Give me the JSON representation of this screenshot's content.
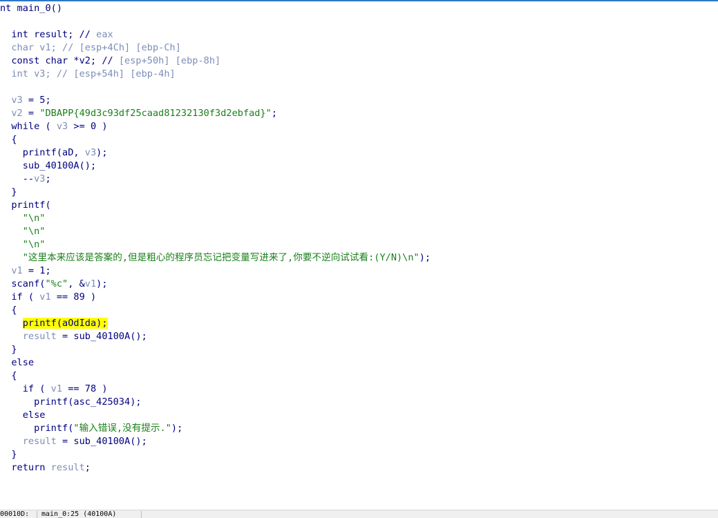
{
  "editor": {
    "lines": [
      [
        {
          "t": "nt main_0()",
          "c": "kw"
        }
      ],
      [
        {
          "t": "",
          "c": "kw"
        }
      ],
      [
        {
          "t": "  int result; // ",
          "c": "kw"
        },
        {
          "t": "eax",
          "c": "cm"
        }
      ],
      [
        {
          "t": "  ",
          "c": "kw"
        },
        {
          "t": "char v1; // [esp+4Ch] [ebp-Ch]",
          "c": "var"
        }
      ],
      [
        {
          "t": "  const char *v2; // ",
          "c": "kw"
        },
        {
          "t": "[esp+50h] [ebp-8h]",
          "c": "cm"
        }
      ],
      [
        {
          "t": "  ",
          "c": "kw"
        },
        {
          "t": "int v3; // [esp+54h] [ebp-4h]",
          "c": "var"
        }
      ],
      [
        {
          "t": "",
          "c": "kw"
        }
      ],
      [
        {
          "t": "  ",
          "c": "kw"
        },
        {
          "t": "v3",
          "c": "var"
        },
        {
          "t": " = 5;",
          "c": "kw"
        }
      ],
      [
        {
          "t": "  ",
          "c": "kw"
        },
        {
          "t": "v2",
          "c": "var"
        },
        {
          "t": " = ",
          "c": "kw"
        },
        {
          "t": "\"DBAPP{49d3c93df25caad81232130f3d2ebfad}\"",
          "c": "str"
        },
        {
          "t": ";",
          "c": "kw"
        }
      ],
      [
        {
          "t": "  while ( ",
          "c": "kw"
        },
        {
          "t": "v3",
          "c": "var"
        },
        {
          "t": " >= 0 )",
          "c": "kw"
        }
      ],
      [
        {
          "t": "  {",
          "c": "kw"
        }
      ],
      [
        {
          "t": "    printf(aD, ",
          "c": "kw"
        },
        {
          "t": "v3",
          "c": "var"
        },
        {
          "t": ");",
          "c": "kw"
        }
      ],
      [
        {
          "t": "    sub_40100A();",
          "c": "kw"
        }
      ],
      [
        {
          "t": "    --",
          "c": "kw"
        },
        {
          "t": "v3",
          "c": "var"
        },
        {
          "t": ";",
          "c": "kw"
        }
      ],
      [
        {
          "t": "  }",
          "c": "kw"
        }
      ],
      [
        {
          "t": "  printf(",
          "c": "kw"
        }
      ],
      [
        {
          "t": "    ",
          "c": "kw"
        },
        {
          "t": "\"\\n\"",
          "c": "str"
        }
      ],
      [
        {
          "t": "    ",
          "c": "kw"
        },
        {
          "t": "\"\\n\"",
          "c": "str"
        }
      ],
      [
        {
          "t": "    ",
          "c": "kw"
        },
        {
          "t": "\"\\n\"",
          "c": "str"
        }
      ],
      [
        {
          "t": "    ",
          "c": "kw"
        },
        {
          "t": "\"这里本来应该是答案的,但是粗心的程序员忘记把变量写进来了,你要不逆向试试看:(Y/N)\\n\"",
          "c": "str"
        },
        {
          "t": ");",
          "c": "kw"
        }
      ],
      [
        {
          "t": "  ",
          "c": "kw"
        },
        {
          "t": "v1",
          "c": "var"
        },
        {
          "t": " = 1;",
          "c": "kw"
        }
      ],
      [
        {
          "t": "  scanf(",
          "c": "kw"
        },
        {
          "t": "\"%c\"",
          "c": "str"
        },
        {
          "t": ", &",
          "c": "kw"
        },
        {
          "t": "v1",
          "c": "var"
        },
        {
          "t": ");",
          "c": "kw"
        }
      ],
      [
        {
          "t": "  if ( ",
          "c": "kw"
        },
        {
          "t": "v1",
          "c": "var"
        },
        {
          "t": " == 89 )",
          "c": "kw"
        }
      ],
      [
        {
          "t": "  {",
          "c": "kw"
        }
      ],
      [
        {
          "t": "    ",
          "c": "kw"
        },
        {
          "t": "printf(aOdIda);",
          "c": "kw",
          "hl": true
        }
      ],
      [
        {
          "t": "    ",
          "c": "kw"
        },
        {
          "t": "result",
          "c": "var"
        },
        {
          "t": " = sub_40100A();",
          "c": "kw"
        }
      ],
      [
        {
          "t": "  }",
          "c": "kw"
        }
      ],
      [
        {
          "t": "  else",
          "c": "kw"
        }
      ],
      [
        {
          "t": "  {",
          "c": "kw"
        }
      ],
      [
        {
          "t": "    if ( ",
          "c": "kw"
        },
        {
          "t": "v1",
          "c": "var"
        },
        {
          "t": " == 78 )",
          "c": "kw"
        }
      ],
      [
        {
          "t": "      printf(asc_425034);",
          "c": "kw"
        }
      ],
      [
        {
          "t": "    else",
          "c": "kw"
        }
      ],
      [
        {
          "t": "      printf(",
          "c": "kw"
        },
        {
          "t": "\"输入错误,没有提示.\"",
          "c": "str"
        },
        {
          "t": ");",
          "c": "kw"
        }
      ],
      [
        {
          "t": "    ",
          "c": "kw"
        },
        {
          "t": "result",
          "c": "var"
        },
        {
          "t": " = sub_40100A();",
          "c": "kw"
        }
      ],
      [
        {
          "t": "  }",
          "c": "kw"
        }
      ],
      [
        {
          "t": "  return ",
          "c": "kw"
        },
        {
          "t": "result",
          "c": "var"
        },
        {
          "t": ";",
          "c": "kw"
        }
      ],
      [
        {
          "t": "",
          "c": "kw"
        }
      ]
    ]
  },
  "statusbar": {
    "address": "00010D:",
    "location": "main_0:25 (40100A)"
  },
  "colors": {
    "keyword": "#000080",
    "variable": "#7c8db6",
    "string": "#1a7f1a",
    "highlight": "#ffff00",
    "accent": "#2b77c9"
  }
}
